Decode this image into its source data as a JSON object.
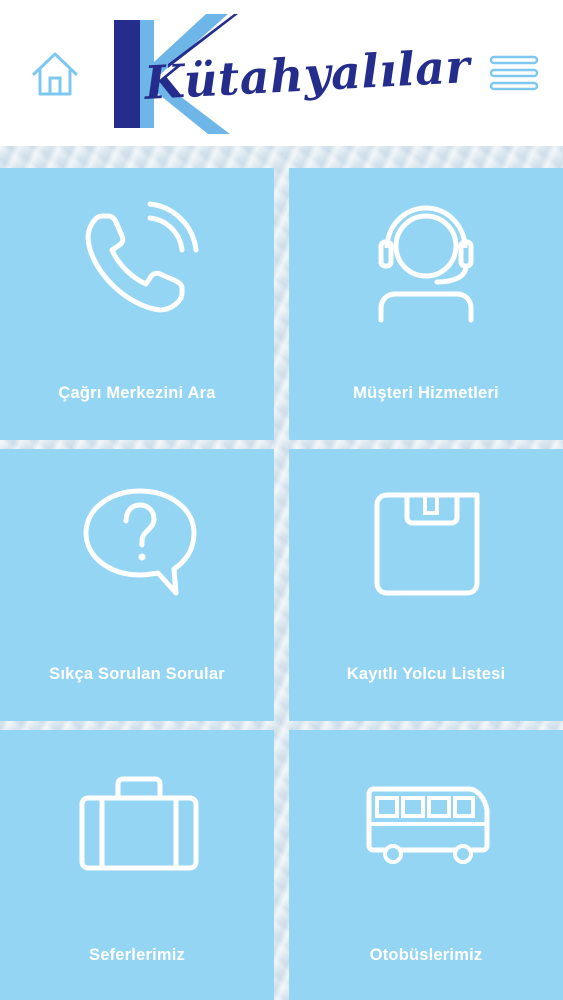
{
  "header": {
    "home_icon": "home-icon",
    "menu_icon": "hamburger-menu-icon",
    "logo_text": "Kütahyalılar",
    "colors": {
      "logo_dark": "#252d8c",
      "logo_light": "#6fb6e8",
      "accent": "#94d5f3"
    }
  },
  "tiles": [
    {
      "label": "Çağrı Merkezini Ara",
      "icon": "phone-icon"
    },
    {
      "label": "Müşteri Hizmetleri",
      "icon": "headset-agent-icon"
    },
    {
      "label": "Sıkça Sorulan Sorular",
      "icon": "question-bubble-icon"
    },
    {
      "label": "Kayıtlı Yolcu Listesi",
      "icon": "floppy-disk-icon"
    },
    {
      "label": "Seferlerimiz",
      "icon": "suitcase-icon"
    },
    {
      "label": "Otobüslerimiz",
      "icon": "bus-icon"
    }
  ]
}
